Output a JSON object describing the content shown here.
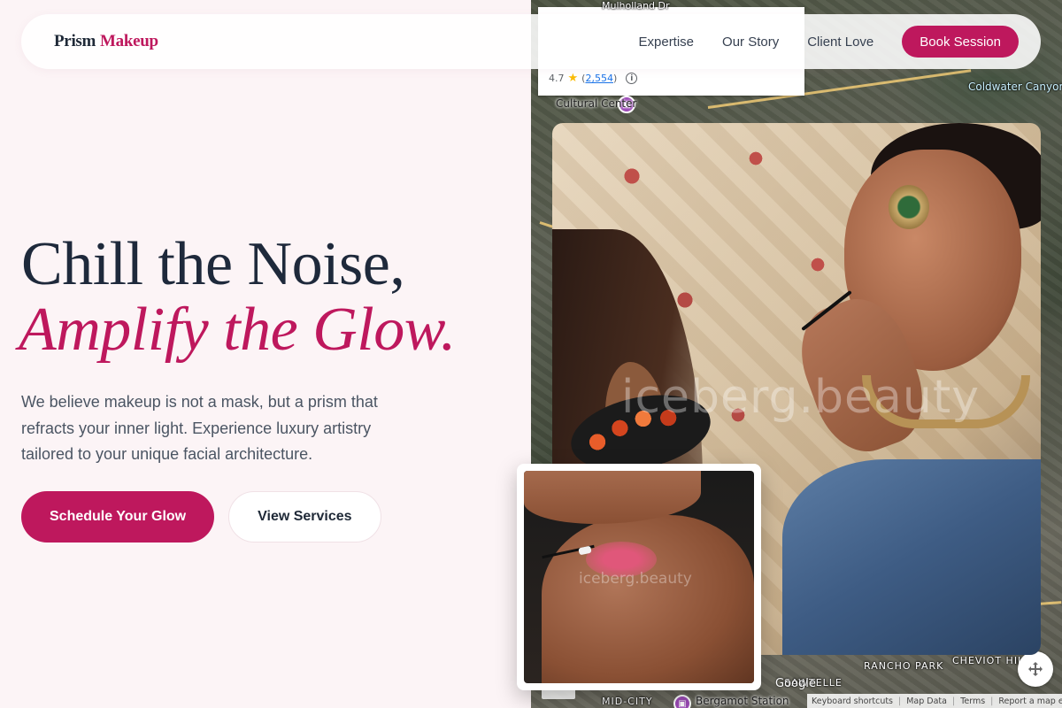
{
  "brand": {
    "name_part1": "Prism",
    "name_part2": "Makeup"
  },
  "nav": {
    "items": [
      "Expertise",
      "Our Story",
      "Client Love"
    ],
    "cta_label": "Book Session"
  },
  "hero": {
    "headline_line1": "Chill the Noise,",
    "headline_line2": "Amplify the Glow.",
    "description": "We believe makeup is not a mask, but a prism that refracts your inner light. Experience luxury artistry tailored to your unique facial architecture.",
    "primary_cta": "Schedule Your Glow",
    "secondary_cta": "View Services"
  },
  "photos": {
    "main_watermark": "iceberg.beauty",
    "small_watermark": "iceberg.beauty"
  },
  "map": {
    "rating": "4.7",
    "review_count": "2,554",
    "labels": {
      "cultural_center": "Cultural Center",
      "mulholland": "Mulholland Dr",
      "coldwater": "Coldwater Canyon Park",
      "rancho_park": "RANCHO PARK",
      "cheviot_hills": "CHEVIOT HILL",
      "mid_city": "MID-CITY",
      "bergamot": "Bergamot Station",
      "sawtelle": "SAWTELLE"
    },
    "google": "Google",
    "footer": {
      "keyboard": "Keyboard shortcuts",
      "map_data": "Map Data",
      "terms": "Terms",
      "report": "Report a map error"
    },
    "colors": {
      "road": "#fad278",
      "poi": "#9c4bb7",
      "rating_star": "#fbbc04",
      "link": "#1a73e8"
    }
  },
  "theme": {
    "accent": "#be185d",
    "background": "#fcf4f6",
    "heading": "#1e293b",
    "body_text": "#4b5563"
  }
}
